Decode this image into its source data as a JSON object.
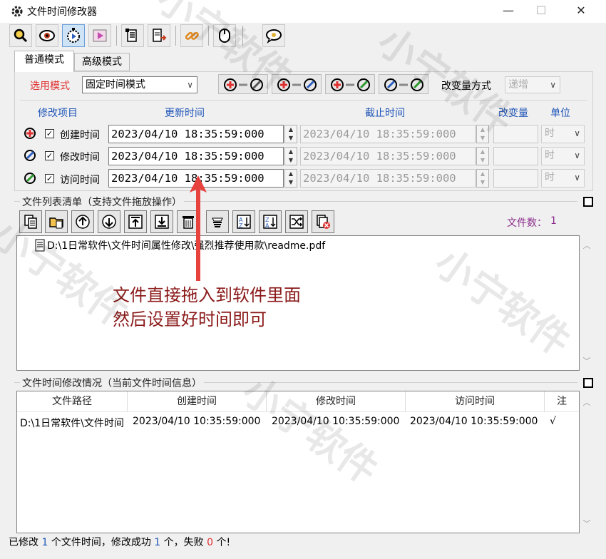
{
  "window": {
    "title": "文件时间修改器",
    "min": "—",
    "max": "☐",
    "close": "✕"
  },
  "toolbar": {
    "icons": [
      "search-icon",
      "eye-icon",
      "timer-icon",
      "play-icon",
      "copy-list-icon",
      "export-icon",
      "link-icon",
      "mouse-icon",
      "chat-icon"
    ]
  },
  "tabs": [
    {
      "label": "普通模式"
    },
    {
      "label": "高级模式"
    }
  ],
  "mode": {
    "label": "选用模式",
    "value": "固定时间模式",
    "change_label": "改变量方式",
    "change_value": "递增"
  },
  "columns": {
    "item": "修改项目",
    "update": "更新时间",
    "end": "截止时间",
    "delta": "改变量",
    "unit": "单位"
  },
  "rows": [
    {
      "label": "创建时间",
      "checked": "✓",
      "update": "2023/04/10 18:35:59:000",
      "end": "2023/04/10 18:35:59:000",
      "unit": "时"
    },
    {
      "label": "修改时间",
      "checked": "✓",
      "update": "2023/04/10 18:35:59:000",
      "end": "2023/04/10 18:35:59:000",
      "unit": "时"
    },
    {
      "label": "访问时间",
      "checked": "✓",
      "update": "2023/04/10 18:35:59:000",
      "end": "2023/04/10 18:35:59:000",
      "unit": "时"
    }
  ],
  "filelist": {
    "title": "文件列表清单（支持文件拖放操作）",
    "count_label": "文件数：",
    "count": "1",
    "files": [
      "D:\\1日常软件\\文件时间属性修改\\强烈推荐使用款\\readme.pdf"
    ]
  },
  "annotation": {
    "line1": "文件直接拖入到软件里面",
    "line2": "然后设置好时间即可"
  },
  "info": {
    "title": "文件时间修改情况（当前文件时间信息）",
    "headers": [
      "文件路径",
      "创建时间",
      "修改时间",
      "访问时间",
      "注"
    ],
    "rows": [
      [
        "D:\\1日常软件\\文件时间",
        "2023/04/10 10:35:59:000",
        "2023/04/10 10:35:59:000",
        "2023/04/10 10:35:59:000",
        "√"
      ]
    ]
  },
  "status": {
    "p1": "已修改",
    "n1": "1",
    "p2": "个文件时间，修改成功",
    "n2": "1",
    "p3": "个，失败",
    "n3": "0",
    "p4": "个!"
  },
  "watermark": "小宁软件",
  "colors": {
    "accent_blue": "#1f55b8",
    "red": "#e03030",
    "annotation": "#8b1a1a"
  }
}
